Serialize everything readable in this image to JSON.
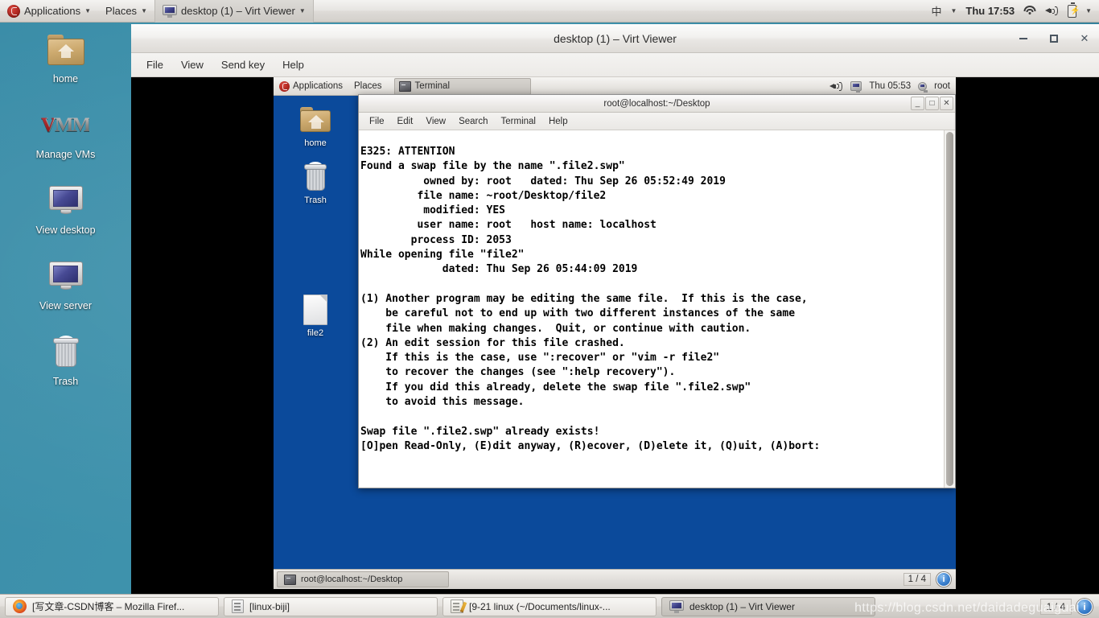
{
  "host_panel": {
    "menus": [
      {
        "label": "Applications",
        "icon": "fedora-logo-icon",
        "caret": "▼"
      },
      {
        "label": "Places",
        "caret": "▼"
      }
    ],
    "active_window": {
      "label": "desktop (1) – Virt Viewer",
      "icon": "monitor-icon",
      "caret": "▼"
    },
    "tray": {
      "input_method": "中",
      "input_caret": "▼",
      "clock": "Thu 17:53",
      "icons": [
        "wifi-icon",
        "volume-icon",
        "battery-icon"
      ],
      "caret": "▼"
    }
  },
  "host_desktop_icons": [
    {
      "label": "home",
      "icon": "home-folder-icon"
    },
    {
      "label": "Manage VMs",
      "icon": "vmm-logo-icon"
    },
    {
      "label": "View desktop",
      "icon": "monitor-icon"
    },
    {
      "label": "View server",
      "icon": "monitor-icon"
    },
    {
      "label": "Trash",
      "icon": "trash-icon"
    }
  ],
  "virt_viewer": {
    "title": "desktop (1) – Virt Viewer",
    "window_buttons": {
      "minimize": "–",
      "maximize": "□",
      "close": "✕"
    },
    "menus": [
      "File",
      "View",
      "Send key",
      "Help"
    ]
  },
  "guest": {
    "panel": {
      "menus": [
        "Applications",
        "Places"
      ],
      "task": {
        "label": "Terminal",
        "icon": "terminal-icon"
      },
      "tray": {
        "icons": [
          "volume-icon",
          "network-disconnected-icon"
        ],
        "clock": "Thu 05:53",
        "user": "root",
        "user_icon": "user-icon"
      }
    },
    "desktop_icons": [
      {
        "label": "home",
        "icon": "home-folder-icon"
      },
      {
        "label": "Trash",
        "icon": "trash-icon"
      },
      {
        "label": "file2",
        "icon": "file-icon"
      }
    ],
    "terminal": {
      "title": "root@localhost:~/Desktop",
      "window_buttons": {
        "minimize": "_",
        "maximize": "□",
        "close": "✕"
      },
      "menus": [
        "File",
        "Edit",
        "View",
        "Search",
        "Terminal",
        "Help"
      ],
      "content": "E325: ATTENTION\nFound a swap file by the name \".file2.swp\"\n          owned by: root   dated: Thu Sep 26 05:52:49 2019\n         file name: ~root/Desktop/file2\n          modified: YES\n         user name: root   host name: localhost\n        process ID: 2053\nWhile opening file \"file2\"\n             dated: Thu Sep 26 05:44:09 2019\n\n(1) Another program may be editing the same file.  If this is the case,\n    be careful not to end up with two different instances of the same\n    file when making changes.  Quit, or continue with caution.\n(2) An edit session for this file crashed.\n    If this is the case, use \":recover\" or \"vim -r file2\"\n    to recover the changes (see \":help recovery\").\n    If you did this already, delete the swap file \".file2.swp\"\n    to avoid this message.\n\nSwap file \".file2.swp\" already exists!\n[O]pen Read-Only, (E)dit anyway, (R)ecover, (D)elete it, (Q)uit, (A)bort:"
    },
    "taskbar": {
      "task": {
        "label": "root@localhost:~/Desktop",
        "icon": "terminal-icon"
      },
      "pager": "1 / 4",
      "info_badge": "i"
    }
  },
  "host_taskbar": {
    "tasks": [
      {
        "label": "[写文章-CSDN博客 – Mozilla Firef...",
        "icon": "firefox-icon",
        "active": false
      },
      {
        "label": "[linux-biji]",
        "icon": "note-icon",
        "active": false
      },
      {
        "label": "[9-21 linux (~/Documents/linux-...",
        "icon": "text-editor-icon",
        "active": false
      },
      {
        "label": "desktop (1) – Virt Viewer",
        "icon": "monitor-icon",
        "active": true
      }
    ],
    "pager": "1 / 4",
    "info_badge": "i"
  },
  "watermark": "https://blog.csdn.net/daidadeguaiguai"
}
